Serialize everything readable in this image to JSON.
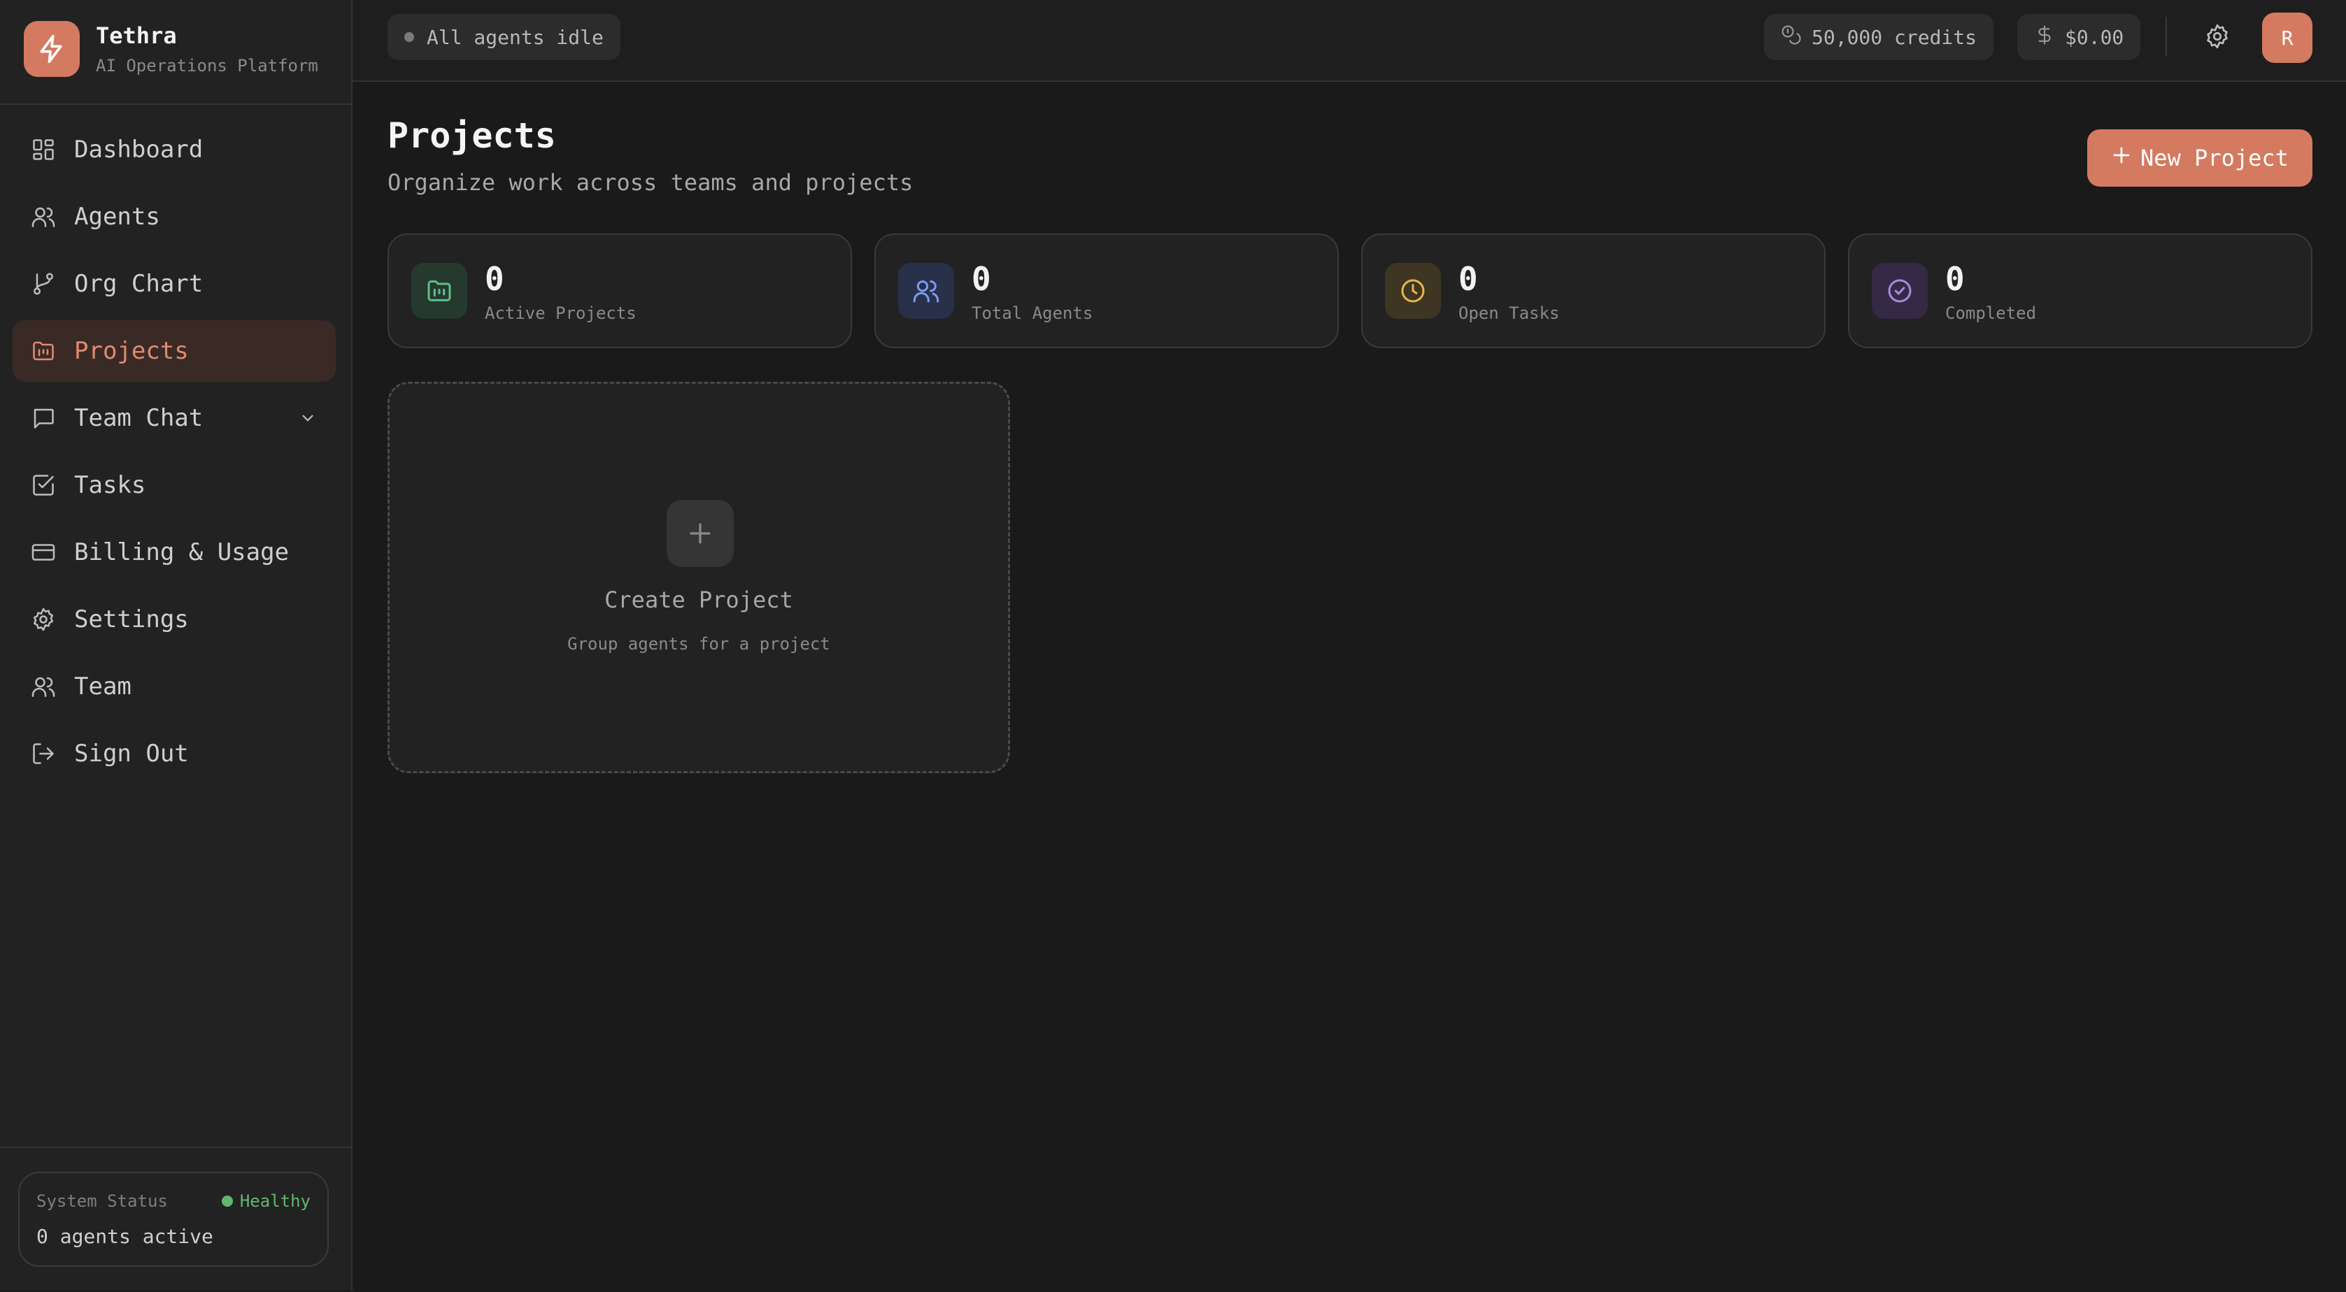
{
  "brand": {
    "name": "Tethra",
    "subtitle": "AI Operations Platform"
  },
  "sidebar": {
    "items": [
      {
        "label": "Dashboard",
        "icon": "dashboard-icon",
        "active": false
      },
      {
        "label": "Agents",
        "icon": "users-icon",
        "active": false
      },
      {
        "label": "Org Chart",
        "icon": "git-branch-icon",
        "active": false
      },
      {
        "label": "Projects",
        "icon": "folder-kanban-icon",
        "active": true
      },
      {
        "label": "Team Chat",
        "icon": "chat-bubble-icon",
        "active": false,
        "expandable": true
      },
      {
        "label": "Tasks",
        "icon": "checkbox-icon",
        "active": false
      },
      {
        "label": "Billing & Usage",
        "icon": "credit-card-icon",
        "active": false
      },
      {
        "label": "Settings",
        "icon": "gear-icon",
        "active": false
      },
      {
        "label": "Team",
        "icon": "users-icon",
        "active": false
      },
      {
        "label": "Sign Out",
        "icon": "sign-out-icon",
        "active": false
      }
    ],
    "status": {
      "title": "System Status",
      "health": "Healthy",
      "agents": "0 agents active"
    }
  },
  "topbar": {
    "agents_status": "All agents idle",
    "credits": "50,000 credits",
    "cash": "$0.00",
    "avatar_initial": "R"
  },
  "main": {
    "title": "Projects",
    "subtitle": "Organize work across teams and projects",
    "new_button": "New Project",
    "stats": [
      {
        "value": "0",
        "label": "Active Projects",
        "icon": "folder-kanban-icon",
        "color": "#5fc08a",
        "bg": "#25392f"
      },
      {
        "value": "0",
        "label": "Total Agents",
        "icon": "users-icon",
        "color": "#7a9bf0",
        "bg": "#28304a"
      },
      {
        "value": "0",
        "label": "Open Tasks",
        "icon": "clock-icon",
        "color": "#e8b64a",
        "bg": "#3e3522"
      },
      {
        "value": "0",
        "label": "Completed",
        "icon": "check-circle-icon",
        "color": "#a88ae0",
        "bg": "#342a45"
      }
    ],
    "create_card": {
      "title": "Create Project",
      "subtitle": "Group agents for a project"
    }
  },
  "colors": {
    "accent": "#d47a60",
    "healthy": "#5fb86d",
    "background": "#1a1a1a",
    "sidebar": "#222222"
  }
}
